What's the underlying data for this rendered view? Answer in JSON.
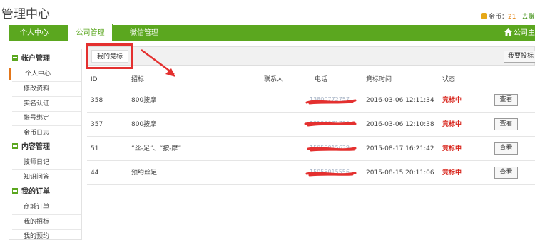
{
  "header": {
    "title": "管理中心",
    "coin_label": "金币：",
    "coin_value": "21",
    "coin_link": "去赚"
  },
  "nav": {
    "personal": "个人中心",
    "company": "公司管理",
    "wechat": "微信管理",
    "right": "公司主"
  },
  "sidebar": {
    "sections": [
      {
        "title": "帐户管理",
        "items": [
          "个人中心",
          "修改资料",
          "实名认证",
          "帐号绑定",
          "金币日志"
        ]
      },
      {
        "title": "内容管理",
        "items": [
          "技师日记",
          "知识问答"
        ]
      },
      {
        "title": "我的订单",
        "items": [
          "商城订单",
          "我的招标",
          "我的预约"
        ]
      }
    ],
    "active_item": "个人中心"
  },
  "tabs": {
    "mine": "我的竞标",
    "want_button": "我要投标"
  },
  "table": {
    "headers": [
      "ID",
      "招标",
      "联系人",
      "电话",
      "竞标时间",
      "状态"
    ],
    "rows": [
      {
        "id": "358",
        "tender": "800按摩",
        "contact": "",
        "phone": "13800772757",
        "time": "2016-03-06 12:11:34",
        "status": "竞标中",
        "action": "查看"
      },
      {
        "id": "357",
        "tender": "800按摩",
        "contact": "",
        "phone": "13137071780",
        "time": "2016-03-06 12:10:38",
        "status": "竞标中",
        "action": "查看"
      },
      {
        "id": "51",
        "tender": "“丝-足”、“按-摩”",
        "contact": "",
        "phone": "15055015639",
        "time": "2015-08-17 16:21:42",
        "status": "竞标中",
        "action": "查看"
      },
      {
        "id": "44",
        "tender": "预约丝足",
        "contact": "",
        "phone": "15055015556",
        "time": "2015-08-15 20:11:06",
        "status": "竞标中",
        "action": "查看"
      }
    ]
  },
  "colors": {
    "brand_green": "#5ba71f",
    "status_red": "#d8241b",
    "annotation_red": "#e4302f"
  }
}
